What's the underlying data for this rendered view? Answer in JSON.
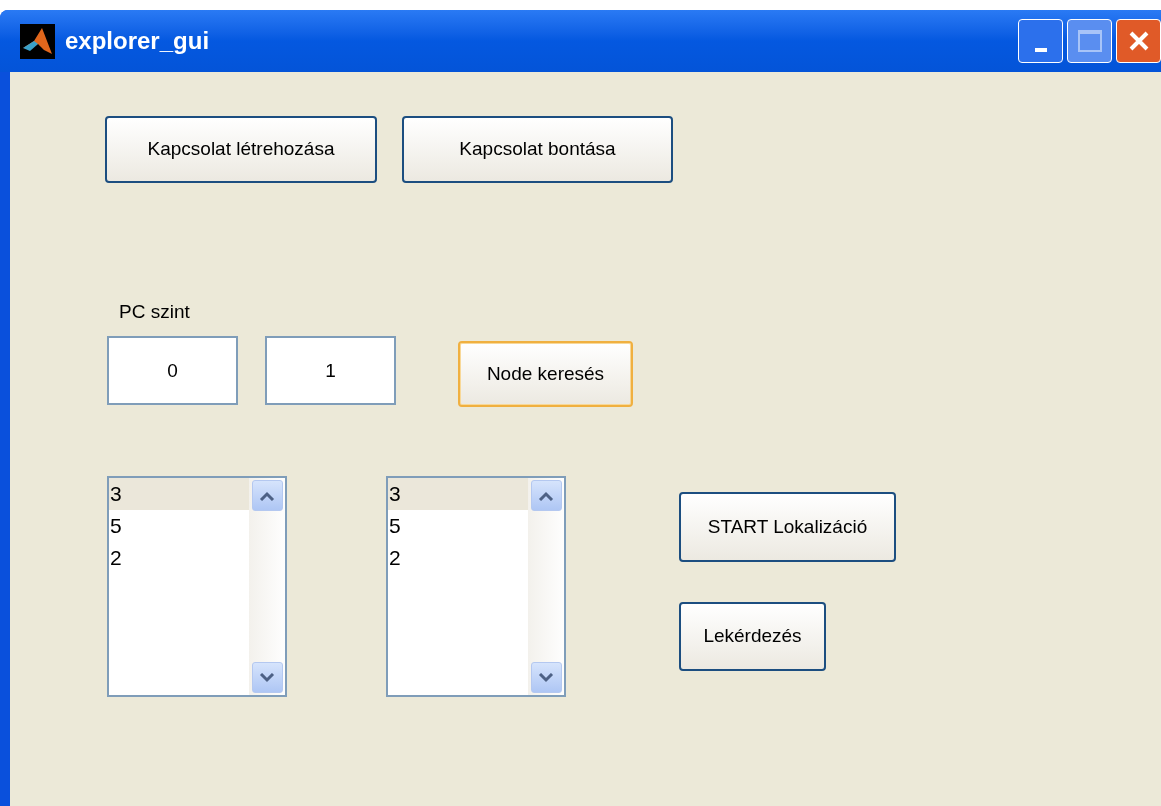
{
  "window": {
    "title": "explorer_gui"
  },
  "connection_buttons": [
    {
      "label": "Kapcsolat létrehozása",
      "focused": false
    },
    {
      "label": "Kapcsolat bontása",
      "focused": false
    }
  ],
  "pc_level": {
    "label": "PC szint",
    "fields": [
      {
        "value": "0"
      },
      {
        "value": "1"
      }
    ]
  },
  "search_button": {
    "label": "Node keresés",
    "focused": true
  },
  "listboxes": [
    {
      "items": [
        {
          "label": "3",
          "selected": true
        },
        {
          "label": "5",
          "selected": false
        },
        {
          "label": "2",
          "selected": false
        }
      ]
    },
    {
      "items": [
        {
          "label": "3",
          "selected": true
        },
        {
          "label": "5",
          "selected": false
        },
        {
          "label": "2",
          "selected": false
        }
      ]
    }
  ],
  "action_buttons": [
    {
      "label": "START Lokalizáció",
      "focused": false
    },
    {
      "label": "Lekérdezés",
      "focused": false
    }
  ]
}
